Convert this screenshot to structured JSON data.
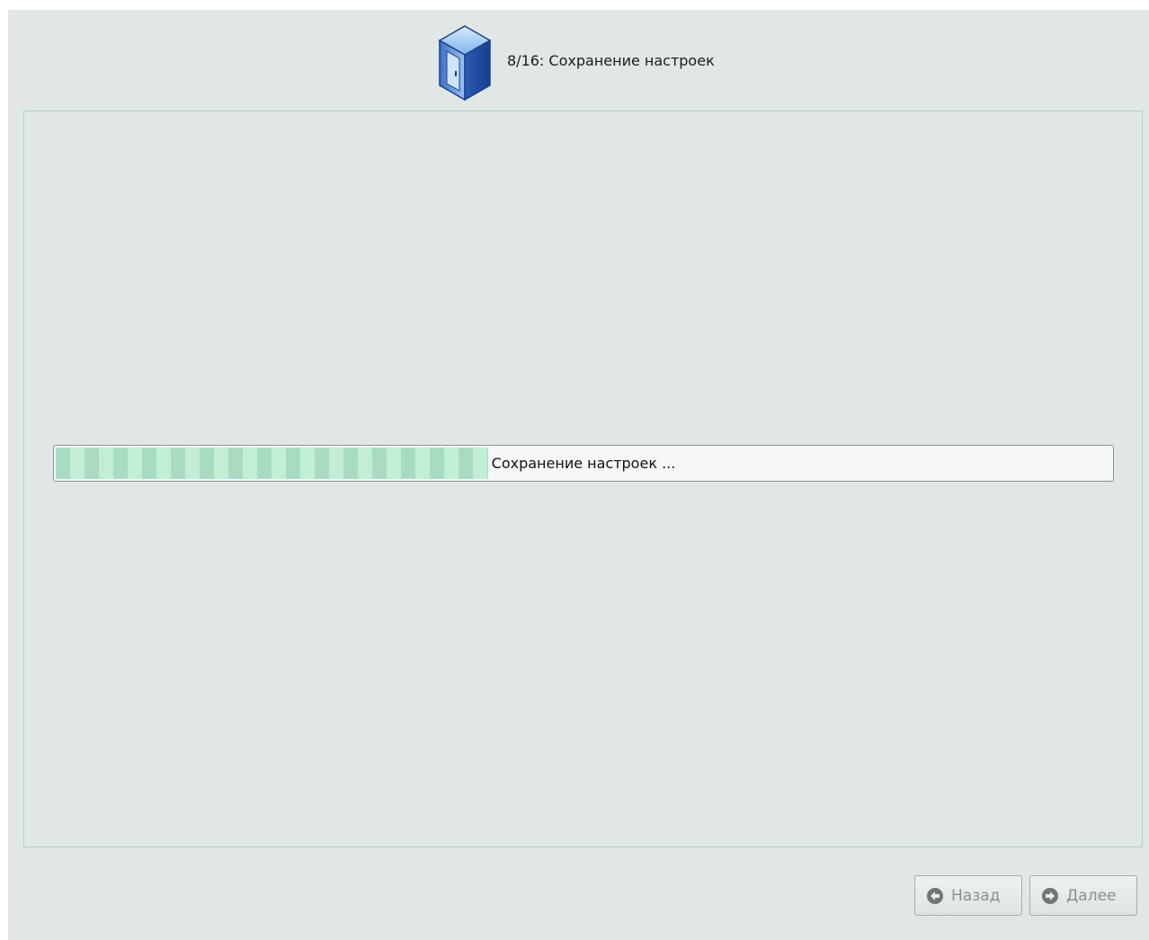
{
  "header": {
    "icon": "computer-tower-icon",
    "step_title": "8/16: Сохранение настроек"
  },
  "progress": {
    "label": "Сохранение настроек ...",
    "fraction": 0.41
  },
  "buttons": {
    "back_label": "Назад",
    "back_icon": "arrow-left-circle-icon",
    "next_label": "Далее",
    "next_icon": "arrow-right-circle-icon"
  },
  "colors": {
    "background": "#e0e7e6",
    "frame_border": "#a4d6c1",
    "progress_fill": "#b8e8cf"
  }
}
